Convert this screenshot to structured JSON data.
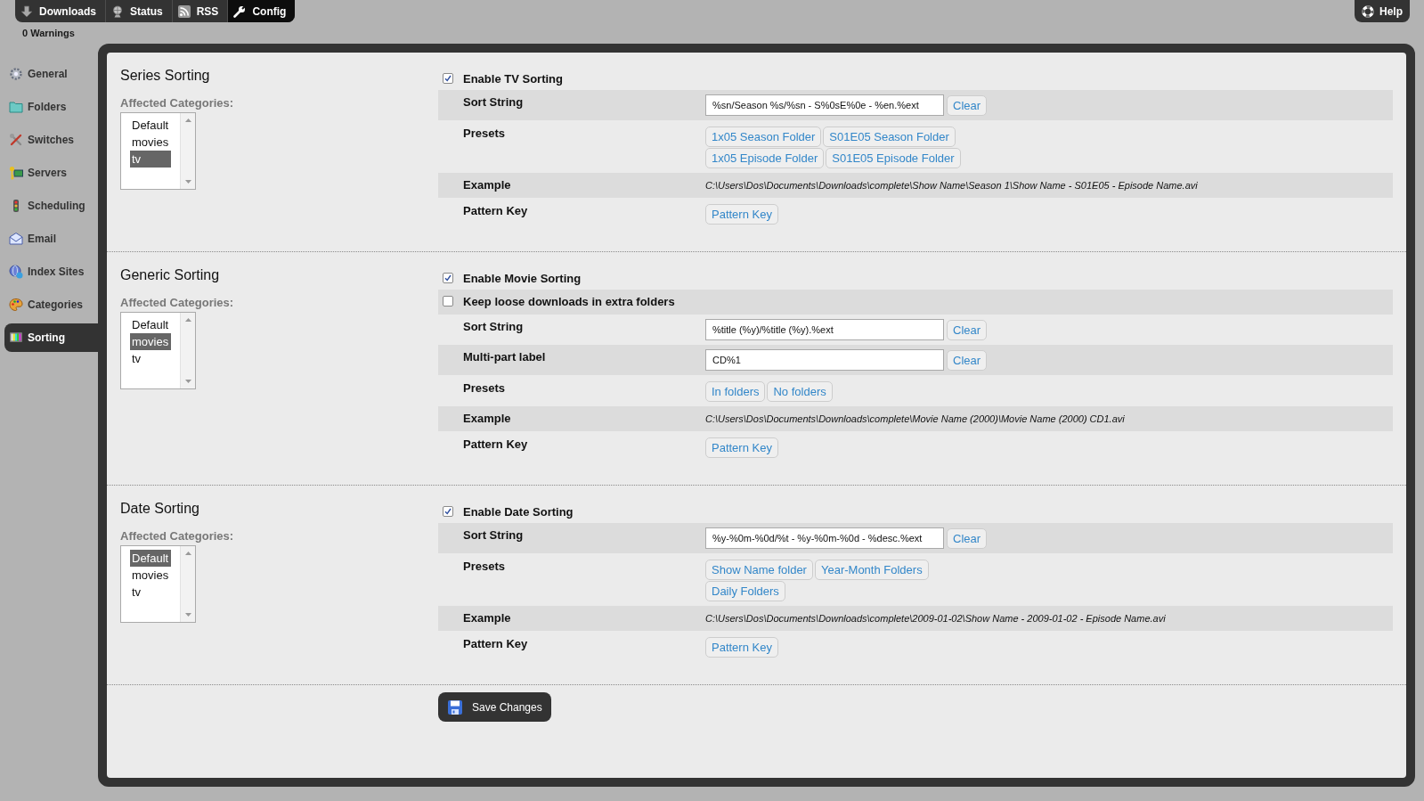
{
  "top_nav": {
    "tabs": [
      {
        "label": "Downloads",
        "selected": false
      },
      {
        "label": "Status",
        "selected": false
      },
      {
        "label": "RSS",
        "selected": false
      },
      {
        "label": "Config",
        "selected": true
      }
    ],
    "help": "Help"
  },
  "warnings": "0 Warnings",
  "sidebar": {
    "items": [
      {
        "label": "General",
        "selected": false
      },
      {
        "label": "Folders",
        "selected": false
      },
      {
        "label": "Switches",
        "selected": false
      },
      {
        "label": "Servers",
        "selected": false
      },
      {
        "label": "Scheduling",
        "selected": false
      },
      {
        "label": "Email",
        "selected": false
      },
      {
        "label": "Index Sites",
        "selected": false
      },
      {
        "label": "Categories",
        "selected": false
      },
      {
        "label": "Sorting",
        "selected": true
      }
    ]
  },
  "sections": [
    {
      "title": "Series Sorting",
      "categories_label": "Affected Categories:",
      "categories": [
        {
          "label": "Default",
          "selected": false
        },
        {
          "label": "movies",
          "selected": false
        },
        {
          "label": "tv",
          "selected": true
        }
      ],
      "rows": [
        {
          "kind": "checkbox",
          "label": "Enable TV Sorting",
          "checked": true
        },
        {
          "kind": "input",
          "label": "Sort String",
          "value": "%sn/Season %s/%sn - S%0sE%0e - %en.%ext",
          "button": "Clear"
        },
        {
          "kind": "presets",
          "label": "Presets",
          "buttons": [
            "1x05 Season Folder",
            "S01E05 Season Folder",
            "1x05 Episode Folder",
            "S01E05 Episode Folder"
          ]
        },
        {
          "kind": "example",
          "label": "Example",
          "value": "C:\\Users\\Dos\\Documents\\Downloads\\complete\\Show Name\\Season 1\\Show Name - S01E05 - Episode Name.avi"
        },
        {
          "kind": "button",
          "label": "Pattern Key",
          "button": "Pattern Key"
        }
      ]
    },
    {
      "title": "Generic Sorting",
      "categories_label": "Affected Categories:",
      "categories": [
        {
          "label": "Default",
          "selected": false
        },
        {
          "label": "movies",
          "selected": true
        },
        {
          "label": "tv",
          "selected": false
        }
      ],
      "rows": [
        {
          "kind": "checkbox",
          "label": "Enable Movie Sorting",
          "checked": true
        },
        {
          "kind": "checkbox",
          "label": "Keep loose downloads in extra folders",
          "checked": false
        },
        {
          "kind": "input",
          "label": "Sort String",
          "value": "%title (%y)/%title (%y).%ext",
          "button": "Clear"
        },
        {
          "kind": "input",
          "label": "Multi-part label",
          "value": "CD%1",
          "button": "Clear"
        },
        {
          "kind": "presets",
          "label": "Presets",
          "buttons": [
            "In folders",
            "No folders"
          ]
        },
        {
          "kind": "example",
          "label": "Example",
          "value": "C:\\Users\\Dos\\Documents\\Downloads\\complete\\Movie Name (2000)\\Movie Name (2000) CD1.avi"
        },
        {
          "kind": "button",
          "label": "Pattern Key",
          "button": "Pattern Key"
        }
      ]
    },
    {
      "title": "Date Sorting",
      "categories_label": "Affected Categories:",
      "categories": [
        {
          "label": "Default",
          "selected": true
        },
        {
          "label": "movies",
          "selected": false
        },
        {
          "label": "tv",
          "selected": false
        }
      ],
      "rows": [
        {
          "kind": "checkbox",
          "label": "Enable Date Sorting",
          "checked": true
        },
        {
          "kind": "input",
          "label": "Sort String",
          "value": "%y-%0m-%0d/%t - %y-%0m-%0d - %desc.%ext",
          "button": "Clear"
        },
        {
          "kind": "presets",
          "label": "Presets",
          "buttons": [
            "Show Name folder",
            "Year-Month Folders",
            "Daily Folders"
          ]
        },
        {
          "kind": "example",
          "label": "Example",
          "value": "C:\\Users\\Dos\\Documents\\Downloads\\complete\\2009-01-02\\Show Name - 2009-01-02 - Episode Name.avi"
        },
        {
          "kind": "button",
          "label": "Pattern Key",
          "button": "Pattern Key"
        }
      ]
    }
  ],
  "save_button": "Save Changes"
}
